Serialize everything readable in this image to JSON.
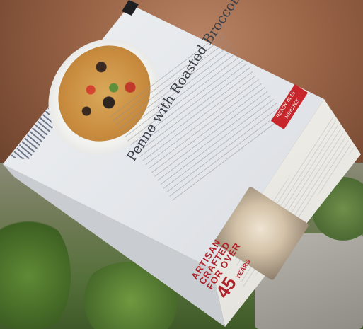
{
  "product": {
    "title": "Penne with Roasted Broccoli & Tomatoes",
    "badge_text": "READY IN 15 MINUTES",
    "artisan_line1": "ARTISAN",
    "artisan_line2": "CRAFTED",
    "artisan_line3": "FOR OVER",
    "artisan_number": "45",
    "artisan_years": "YEARS"
  },
  "colors": {
    "box": "#e3e6ea",
    "accent_red": "#c7262c",
    "title_text": "#3a3f48"
  }
}
